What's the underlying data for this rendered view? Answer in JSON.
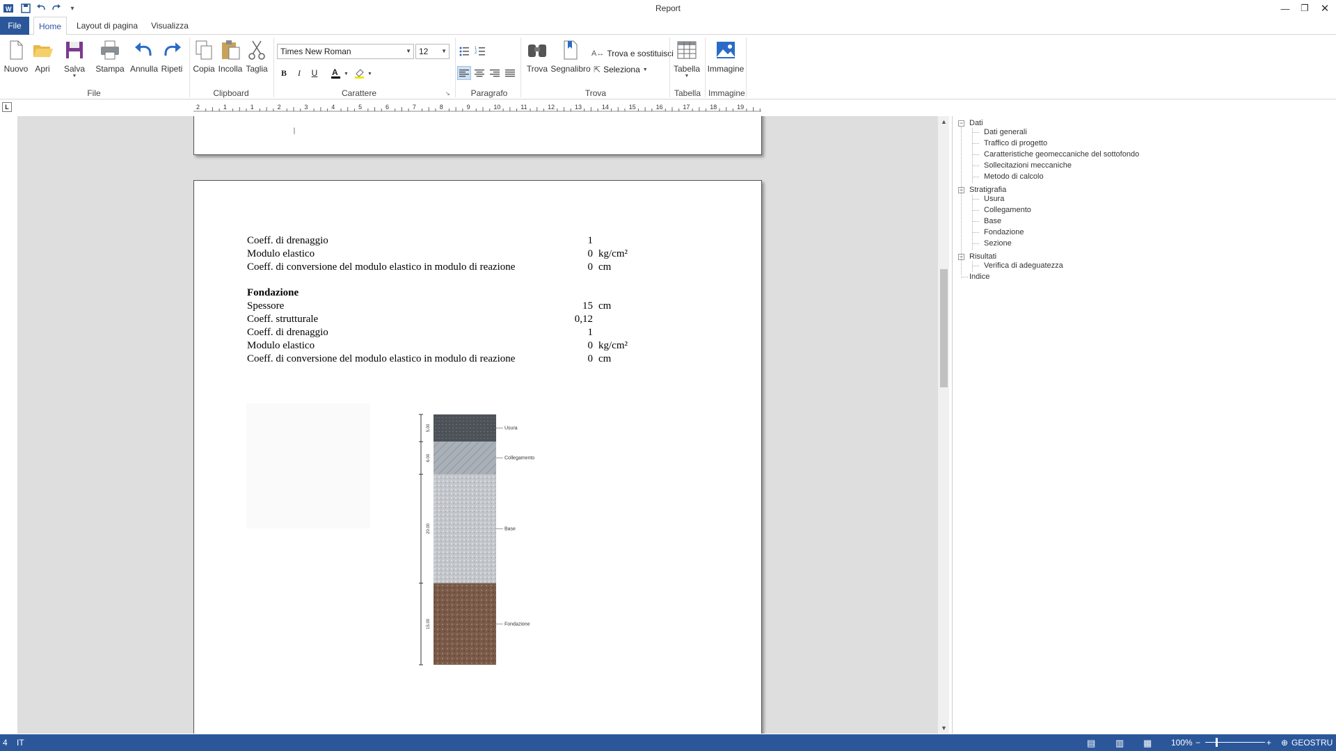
{
  "window": {
    "title": "Report"
  },
  "tabs": [
    "File",
    "Home",
    "Layout di pagina",
    "Visualizza"
  ],
  "ribbon": {
    "file_group": {
      "label": "File",
      "nuovo": "Nuovo",
      "apri": "Apri",
      "salva": "Salva",
      "stampa": "Stampa",
      "annulla": "Annulla",
      "ripeti": "Ripeti"
    },
    "clipboard_group": {
      "label": "Clipboard",
      "copia": "Copia",
      "incolla": "Incolla",
      "taglia": "Taglia"
    },
    "carattere_group": {
      "label": "Carattere",
      "font": "Times New Roman",
      "size": "12",
      "bold": "B",
      "italic": "I",
      "underline": "U"
    },
    "paragrafo_group": {
      "label": "Paragrafo"
    },
    "trova_group": {
      "label": "Trova",
      "trova": "Trova",
      "segnalibro": "Segnalibro",
      "trova_sostituisci": "Trova e sostituisci",
      "seleziona": "Seleziona"
    },
    "tabella_group": {
      "label": "Tabella",
      "tabella": "Tabella"
    },
    "immagine_group": {
      "label": "Immagine",
      "immagine": "Immagine"
    }
  },
  "ruler": {
    "ticks": [
      "2",
      "1",
      "1",
      "2",
      "3",
      "4",
      "5",
      "6",
      "7",
      "8",
      "9",
      "10",
      "11",
      "12",
      "13",
      "14",
      "15",
      "16",
      "17",
      "18",
      "19"
    ]
  },
  "document": {
    "rows1": [
      {
        "label": "Coeff. di drenaggio",
        "value": "1",
        "unit": ""
      },
      {
        "label": "Modulo elastico",
        "value": "0",
        "unit": "kg/cm²"
      },
      {
        "label": "Coeff. di conversione del modulo elastico in modulo di reazione",
        "value": "0",
        "unit": "cm"
      }
    ],
    "section_heading": "Fondazione",
    "rows2": [
      {
        "label": "Spessore",
        "value": "15",
        "unit": "cm"
      },
      {
        "label": "Coeff. strutturale",
        "value": "0,12",
        "unit": ""
      },
      {
        "label": "Coeff. di drenaggio",
        "value": "1",
        "unit": ""
      },
      {
        "label": "Modulo elastico",
        "value": "0",
        "unit": "kg/cm²"
      },
      {
        "label": "Coeff. di conversione del modulo elastico in modulo di reazione",
        "value": "0",
        "unit": "cm"
      }
    ],
    "stratigraphy": {
      "layers": [
        {
          "name": "Usura",
          "thickness": "5.00",
          "color": "#4d5258"
        },
        {
          "name": "Collegamento",
          "thickness": "6.00",
          "color": "#a9b0b7"
        },
        {
          "name": "Base",
          "thickness": "20.00",
          "color": "#c3c7cc"
        },
        {
          "name": "Fondazione",
          "thickness": "15.00",
          "color": "#7a5a48"
        }
      ]
    }
  },
  "tree": {
    "groups": [
      {
        "label": "Dati",
        "children": [
          "Dati generali",
          "Traffico di progetto",
          "Caratteristiche geomeccaniche del sottofondo",
          "Sollecitazioni meccaniche",
          "Metodo di calcolo"
        ]
      },
      {
        "label": "Stratigrafia",
        "children": [
          "Usura",
          "Collegamento",
          "Base",
          "Fondazione",
          "Sezione"
        ]
      },
      {
        "label": "Risultati",
        "children": [
          "Verifica di adeguatezza"
        ]
      }
    ],
    "leaf": "Indice"
  },
  "statusbar": {
    "page": "4",
    "language": "IT",
    "zoom": "100%",
    "brand": "GEOSTRU"
  },
  "colors": {
    "accent": "#2b579a"
  }
}
